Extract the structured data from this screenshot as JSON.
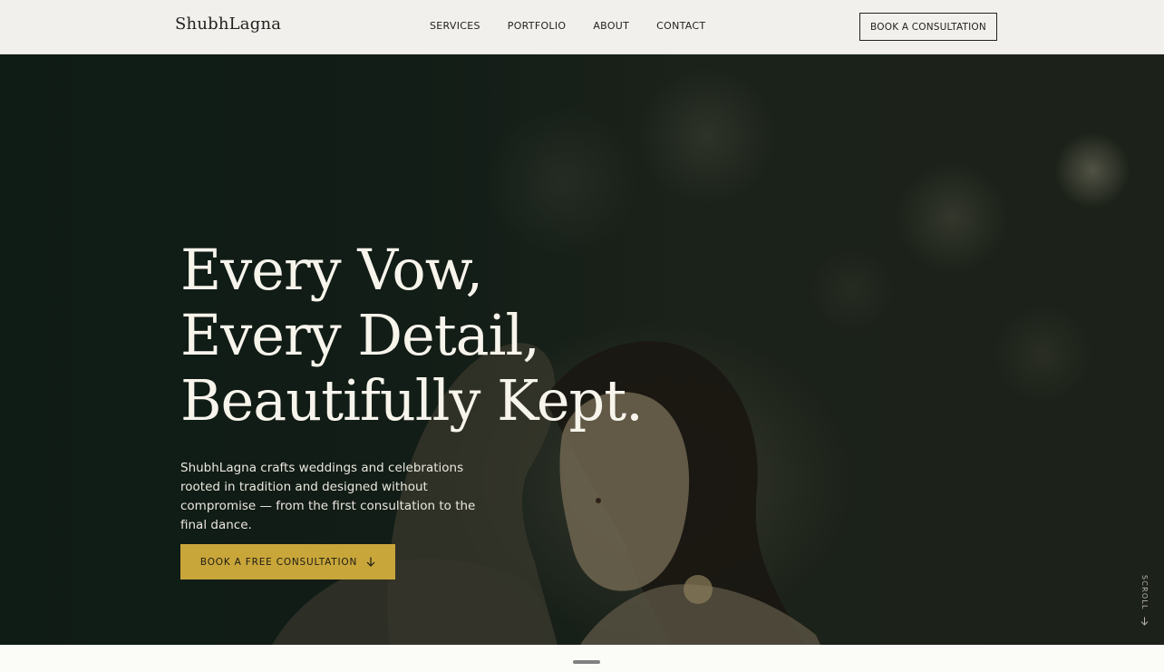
{
  "brand": {
    "name": "ShubhLagna"
  },
  "nav": {
    "items": [
      {
        "label": "SERVICES"
      },
      {
        "label": "PORTFOLIO"
      },
      {
        "label": "ABOUT"
      },
      {
        "label": "CONTACT"
      }
    ],
    "cta_label": "BOOK A CONSULTATION"
  },
  "hero": {
    "headline_lines": [
      "Every Vow,",
      "Every Detail,",
      "Beautifully Kept."
    ],
    "description": "ShubhLagna crafts weddings and celebrations rooted in tradition and designed without compromise — from the first consultation to the final dance.",
    "cta_label": "BOOK A FREE CONSULTATION",
    "cta_icon": "arrow-down-icon",
    "scroll_label": "SCROLL",
    "scroll_icon": "arrow-down-icon"
  },
  "colors": {
    "accent": "#c9a63a",
    "header_bg": "#f2f0ec",
    "hero_bg": "#121d17",
    "hero_text": "#f7f4ec"
  }
}
